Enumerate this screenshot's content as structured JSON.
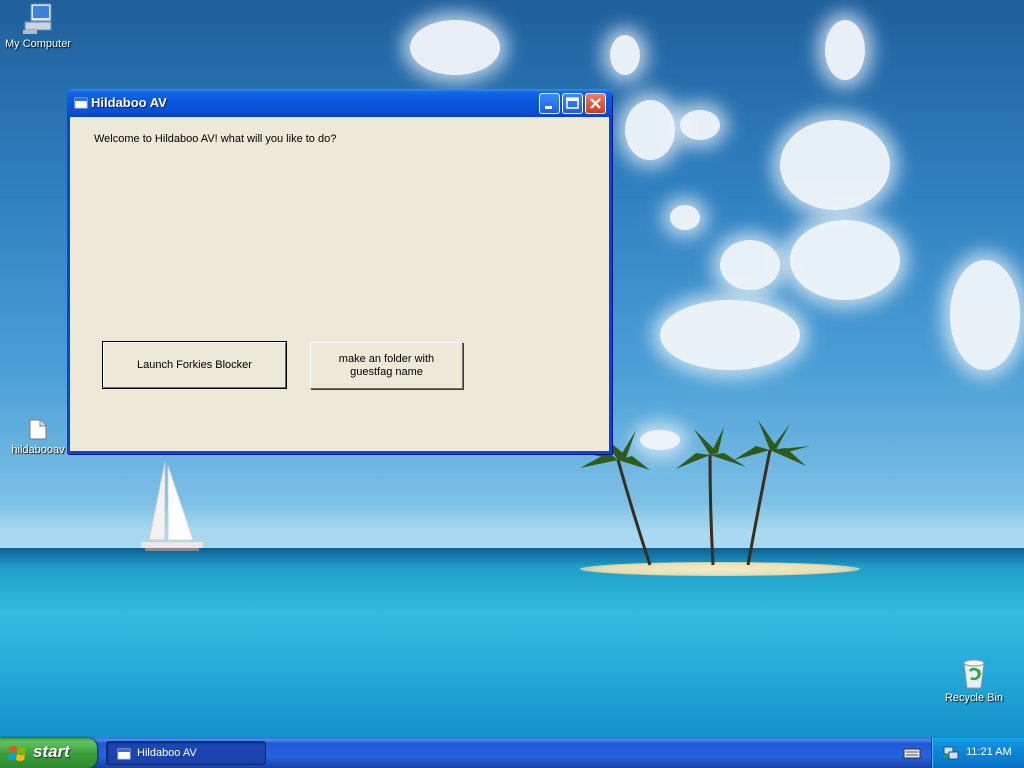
{
  "desktop": {
    "icons": [
      {
        "label": "My Computer",
        "icon": "my-computer-icon"
      },
      {
        "label": "hildabooav",
        "icon": "folder-icon"
      },
      {
        "label": "Recycle Bin",
        "icon": "recycle-bin-icon"
      }
    ]
  },
  "window": {
    "title": "Hildaboo AV",
    "icon": "app-window-icon",
    "welcome_text": "Welcome to Hildaboo AV! what will you like to do?",
    "buttons": [
      {
        "label": "Launch Forkies Blocker",
        "default": true
      },
      {
        "label": "make an folder with guestfag name"
      }
    ],
    "controls": [
      "minimize",
      "maximize",
      "close"
    ]
  },
  "taskbar": {
    "start_label": "start",
    "tasks": [
      {
        "label": "Hildaboo AV",
        "icon": "app-window-icon",
        "active": true
      }
    ],
    "tray": {
      "clock": "11:21 AM",
      "icons": [
        "keyboard-icon",
        "network-icon"
      ]
    }
  },
  "colors": {
    "title_bar": "#0a55dc",
    "window_face": "#ece9d8",
    "taskbar": "#2663e0",
    "start_button": "#3a9d3a",
    "tray": "#0c7fd0"
  }
}
